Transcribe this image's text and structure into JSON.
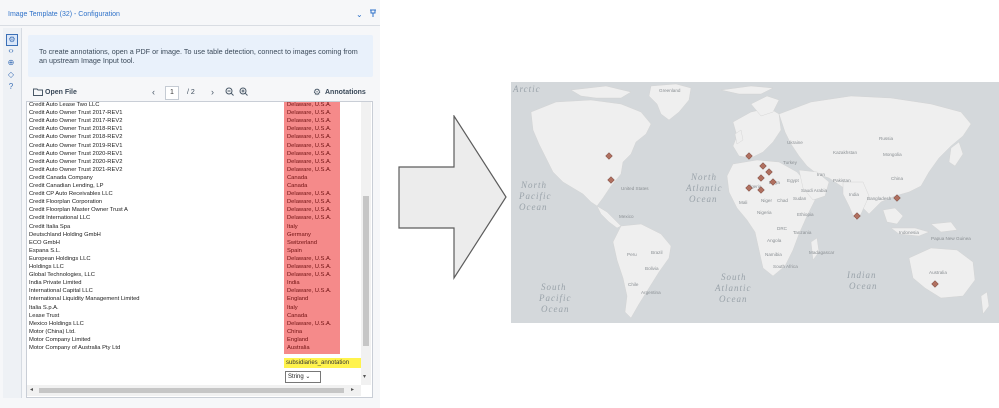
{
  "panel": {
    "title": "Image Template (32) - Configuration",
    "collapse_icon": "⌄",
    "pin_icon": "📌",
    "info_text": "To create annotations, open a PDF or image. To use table detection, connect to images coming from an upstream Image Input tool.",
    "open_file_label": "Open File",
    "page_current": "1",
    "page_total": "/ 2",
    "annotations_label": "Annotations",
    "annotation_tag": "subsidiaries_annotation",
    "type_select_value": "String"
  },
  "icons": {
    "gear": "gear-icon",
    "code": "code-icon",
    "add": "add-icon",
    "tag": "tag-icon",
    "help": "help-icon",
    "folder": "folder-icon",
    "zoom_in": "zoom-in-icon",
    "zoom_out": "zoom-out-icon"
  },
  "document": {
    "rows": [
      [
        "Credit Auto Lease Two LLC",
        "Delaware, U.S.A."
      ],
      [
        "Credit Auto Owner Trust 2017-REV1",
        "Delaware, U.S.A."
      ],
      [
        "Credit Auto Owner Trust 2017-REV2",
        "Delaware, U.S.A."
      ],
      [
        "Credit Auto Owner Trust 2018-REV1",
        "Delaware, U.S.A."
      ],
      [
        "Credit Auto Owner Trust 2018-REV2",
        "Delaware, U.S.A."
      ],
      [
        "Credit Auto Owner Trust 2019-REV1",
        "Delaware, U.S.A."
      ],
      [
        "Credit Auto Owner Trust 2020-REV1",
        "Delaware, U.S.A."
      ],
      [
        "Credit Auto Owner Trust 2020-REV2",
        "Delaware, U.S.A."
      ],
      [
        "Credit Auto Owner Trust 2021-REV2",
        "Delaware, U.S.A."
      ],
      [
        "Credit Canada Company",
        "Canada"
      ],
      [
        "Credit Canadian Lending, LP",
        "Canada"
      ],
      [
        "Credit CP Auto Receivables LLC",
        "Delaware, U.S.A."
      ],
      [
        "Credit Floorplan Corporation",
        "Delaware, U.S.A."
      ],
      [
        "Credit Floorplan Master Owner Trust A",
        "Delaware, U.S.A."
      ],
      [
        "Credit International LLC",
        "Delaware, U.S.A."
      ],
      [
        "Credit Italia Spa",
        "Italy"
      ],
      [
        "Deutschland Holding GmbH",
        "Germany"
      ],
      [
        "ECO GmbH",
        "Switzerland"
      ],
      [
        "Espana S.L.",
        "Spain"
      ],
      [
        "European Holdings LLC",
        "Delaware, U.S.A."
      ],
      [
        "Holdings LLC",
        "Delaware, U.S.A."
      ],
      [
        "Global Technologies, LLC",
        "Delaware, U.S.A."
      ],
      [
        "India Private Limited",
        "India"
      ],
      [
        "International Capital LLC",
        "Delaware, U.S.A."
      ],
      [
        "International Liquidity Management Limited",
        "England"
      ],
      [
        "Italia S.p.A.",
        "Italy"
      ],
      [
        "Lease Trust",
        "Canada"
      ],
      [
        "Mexico Holdings LLC",
        "Delaware, U.S.A."
      ],
      [
        "Motor (China) Ltd.",
        "China"
      ],
      [
        "Motor Company Limited",
        "England"
      ],
      [
        "Motor Company of Australia Pty Ltd",
        "Australia"
      ]
    ]
  },
  "map": {
    "labels": {
      "arctic": "Arctic",
      "north_pacific": [
        "North",
        "Pacific",
        "Ocean"
      ],
      "north_atlantic": [
        "North",
        "Atlantic",
        "Ocean"
      ],
      "south_pacific": [
        "South",
        "Pacific",
        "Ocean"
      ],
      "south_atlantic": [
        "South",
        "Atlantic",
        "Ocean"
      ],
      "indian": [
        "Indian",
        "Ocean"
      ],
      "greenland": "Greenland",
      "russia": "Russia",
      "united_states": "United States",
      "mexico": "Mexico",
      "brazil": "Brazil",
      "peru": "Peru",
      "bolivia": "Bolivia",
      "argentina": "Argentina",
      "chile": "Chile",
      "algeria": "Algeria",
      "libya": "Libya",
      "egypt": "Egypt",
      "mali": "Mali",
      "niger": "Niger",
      "chad": "Chad",
      "sudan": "Sudan",
      "nigeria": "Nigeria",
      "ethiopia": "Ethiopia",
      "drc": "DRC",
      "angola": "Angola",
      "namibia": "Namibia",
      "south_africa": "South Africa",
      "tanzania": "Tanzania",
      "madagascar": "Madagascar",
      "kazakhstan": "Kazakhstan",
      "mongolia": "Mongolia",
      "china": "China",
      "iran": "Iran",
      "saudi_arabia": "Saudi Arabia",
      "pakistan": "Pakistan",
      "india": "India",
      "bangladesh": "Bangladesh",
      "turkey": "Turkey",
      "ukraine": "Ukraine",
      "australia": "Australia",
      "indonesia": "Indonesia",
      "papua_new_guinea": "Papua New Guinea"
    },
    "marker_color": "#b07060"
  },
  "colors": {
    "accent": "#2f72c9",
    "highlight_red": "#f58a8a",
    "highlight_yellow": "#fff34d"
  }
}
